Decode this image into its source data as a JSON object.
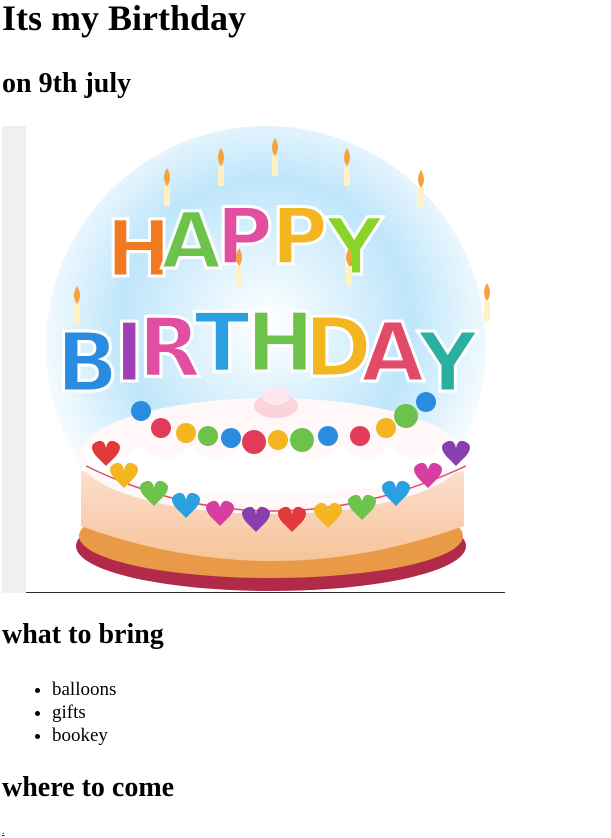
{
  "page": {
    "title": "Its my Birthday",
    "subtitle": "on 9th july"
  },
  "image": {
    "headline_top": "HAPPY",
    "headline_bottom": "BIRTHDAY",
    "icon": "birthday-cake-icon"
  },
  "bring": {
    "heading": "what to bring",
    "items": [
      "balloons",
      "gifts",
      "bookey"
    ]
  },
  "where": {
    "heading": "where to come",
    "link_text": "."
  },
  "colors": {
    "link": "#0000ee",
    "text": "#000000"
  }
}
